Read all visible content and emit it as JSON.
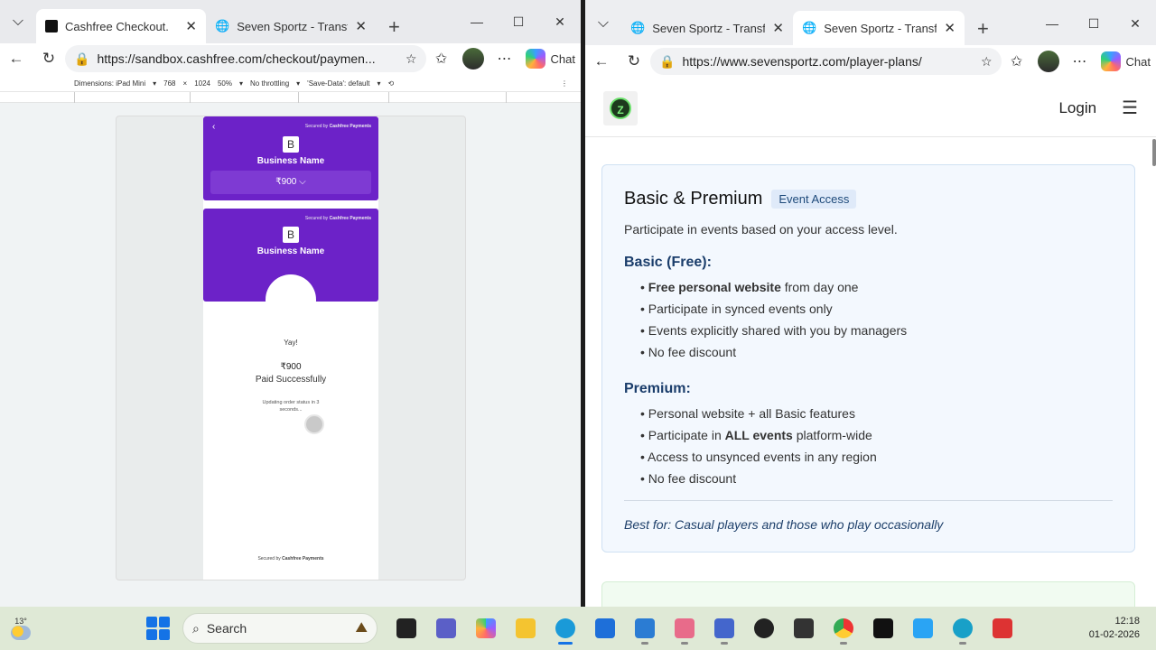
{
  "left_window": {
    "tabs": [
      {
        "title": "Cashfree Checkout.",
        "active": true
      },
      {
        "title": "Seven Sportz - Transform",
        "active": false
      }
    ],
    "url": "https://sandbox.cashfree.com/checkout/paymen...",
    "copilot_label": "Chat",
    "devtools": {
      "dimensions": "Dimensions: iPad Mini",
      "width": "768",
      "height": "1024",
      "zoom": "50%",
      "throttle": "No throttling",
      "save_data": "'Save-Data': default"
    },
    "checkout": {
      "secured_by": "Secured by",
      "brand": "Cashfree Payments",
      "business_initial": "B",
      "business_name": "Business Name",
      "amount_pill": "₹900 ⌵",
      "yay": "Yay!",
      "amount": "₹900",
      "paid": "Paid Successfully",
      "updating_line1": "Updating order status in 3",
      "updating_line2": "seconds..."
    }
  },
  "right_window": {
    "tabs": [
      {
        "title": "Seven Sportz - Transform",
        "active": false
      },
      {
        "title": "Seven Sportz - Transform",
        "active": true
      }
    ],
    "url": "https://www.sevensportz.com/player-plans/",
    "copilot_label": "Chat",
    "site": {
      "login": "Login",
      "logo_letter": "Z",
      "card": {
        "title": "Basic & Premium",
        "badge": "Event Access",
        "description": "Participate in events based on your access level.",
        "basic_heading": "Basic (Free):",
        "basic_items": [
          {
            "bold": "Free personal website",
            "rest": " from day one"
          },
          {
            "bold": "",
            "rest": "Participate in synced events only"
          },
          {
            "bold": "",
            "rest": "Events explicitly shared with you by managers"
          },
          {
            "bold": "",
            "rest": "No fee discount"
          }
        ],
        "premium_heading": "Premium:",
        "premium_items": [
          {
            "pre": "Personal website + all Basic features",
            "bold": "",
            "post": ""
          },
          {
            "pre": "Participate in ",
            "bold": "ALL events",
            "post": " platform-wide"
          },
          {
            "pre": "Access to unsynced events in any region",
            "bold": "",
            "post": ""
          },
          {
            "pre": "No fee discount",
            "bold": "",
            "post": ""
          }
        ],
        "best_for": "Best for: Casual players and those who play occasionally"
      }
    }
  },
  "taskbar": {
    "temperature": "13°",
    "search_placeholder": "Search",
    "time": "12:18",
    "date": "01-02-2026"
  },
  "colors": {
    "cashfree_purple": "#6c22c8",
    "card_bg": "#f3f8fe",
    "taskbar_bg": "#dfe9d6"
  }
}
